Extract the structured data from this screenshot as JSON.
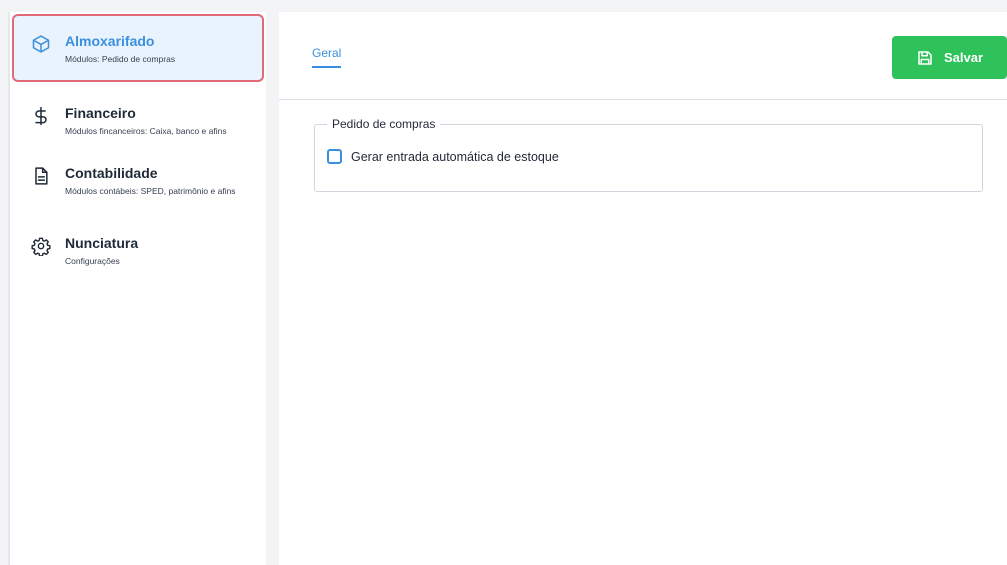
{
  "sidebar": {
    "items": [
      {
        "title": "Almoxarifado",
        "subtitle": "Módulos: Pedido de compras",
        "icon": "cube-icon",
        "active": true
      },
      {
        "title": "Financeiro",
        "subtitle": "Módulos fincanceiros: Caixa, banco e afins",
        "icon": "dollar-icon",
        "active": false
      },
      {
        "title": "Contabilidade",
        "subtitle": "Módulos contábeis: SPED, patrimônio e afins",
        "icon": "document-icon",
        "active": false
      },
      {
        "title": "Nunciatura",
        "subtitle": "Configurações",
        "icon": "gear-icon",
        "active": false
      }
    ]
  },
  "main": {
    "tabs": [
      {
        "label": "Geral",
        "active": true
      }
    ],
    "save_label": "Salvar",
    "group": {
      "legend": "Pedido de compras",
      "checkbox_label": "Gerar entrada automática de estoque",
      "checked": false
    }
  },
  "colors": {
    "accent": "#3b8fde",
    "save": "#2fc25b",
    "active_border": "#e06a75",
    "active_bg": "#e8f3fd"
  }
}
